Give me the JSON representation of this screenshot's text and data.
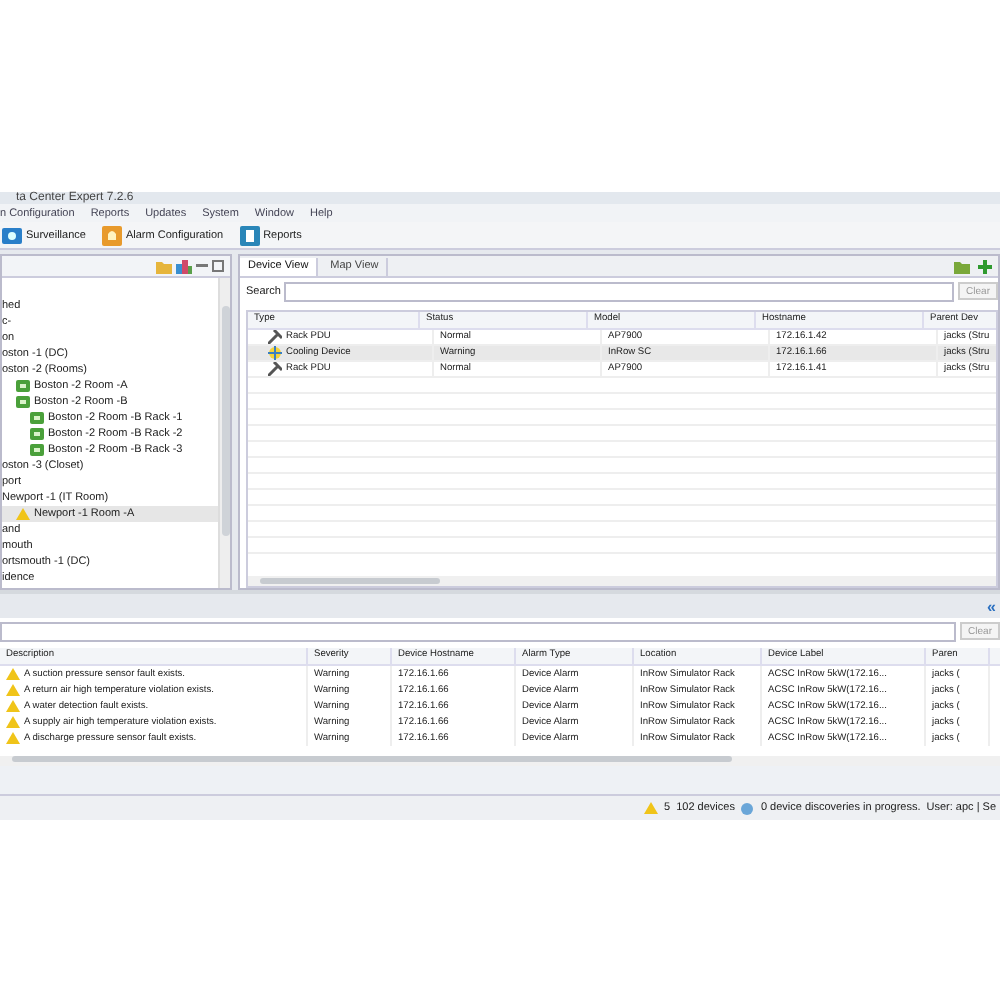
{
  "window": {
    "title": "ta Center Expert 7.2.6"
  },
  "menu": [
    "n Configuration",
    "Reports",
    "Updates",
    "System",
    "Window",
    "Help"
  ],
  "toolbar": [
    {
      "label": "Surveillance",
      "kind": "surveillance"
    },
    {
      "label": "Alarm Configuration",
      "kind": "alarm"
    },
    {
      "label": "Reports",
      "kind": "reports"
    }
  ],
  "tree": [
    {
      "label": "hed",
      "selected": false
    },
    {
      "label": "c-",
      "selected": false
    },
    {
      "label": "on",
      "selected": false
    },
    {
      "label": "oston -1 (DC)",
      "selected": false
    },
    {
      "label": "oston -2 (Rooms)",
      "selected": false,
      "children": [
        {
          "label": "Boston -2 Room -A",
          "kind": "room",
          "selected": false
        },
        {
          "label": "Boston -2 Room -B",
          "kind": "room",
          "selected": false,
          "children": [
            {
              "label": "Boston -2 Room -B Rack -1",
              "kind": "room",
              "selected": false
            },
            {
              "label": "Boston -2 Room -B Rack -2",
              "kind": "room",
              "selected": false
            },
            {
              "label": "Boston -2 Room -B Rack -3",
              "kind": "room",
              "selected": false
            }
          ]
        }
      ]
    },
    {
      "label": "oston -3 (Closet)",
      "selected": false
    },
    {
      "label": "port",
      "selected": false
    },
    {
      "label": "Newport -1 (IT Room)",
      "selected": false,
      "children": [
        {
          "label": "Newport -1 Room -A",
          "kind": "warning",
          "selected": true
        }
      ]
    },
    {
      "label": "and",
      "selected": false
    },
    {
      "label": "mouth",
      "selected": false
    },
    {
      "label": "ortsmouth -1 (DC)",
      "selected": false
    },
    {
      "label": "idence",
      "selected": false
    }
  ],
  "view_tabs": [
    {
      "label": "Device View",
      "selected": true
    },
    {
      "label": "Map View",
      "selected": false
    }
  ],
  "search": {
    "label": "Search",
    "clear": "Clear"
  },
  "devices": {
    "columns": [
      "Type",
      "Status",
      "Model",
      "Hostname",
      "Parent Dev"
    ],
    "rows": [
      {
        "kind": "pdu",
        "cells": [
          "Rack PDU",
          "Normal",
          "AP7900",
          "172.16.1.42",
          "jacks (Stru"
        ],
        "selected": false
      },
      {
        "kind": "cooling",
        "cells": [
          "Cooling Device",
          "Warning",
          "InRow SC",
          "172.16.1.66",
          "jacks (Stru"
        ],
        "selected": true
      },
      {
        "kind": "pdu",
        "cells": [
          "Rack PDU",
          "Normal",
          "AP7900",
          "172.16.1.41",
          "jacks (Stru"
        ],
        "selected": false
      }
    ]
  },
  "alarms": {
    "collapse": "«",
    "clear": "Clear",
    "columns": [
      "Description",
      "Severity",
      "Device Hostname",
      "Alarm Type",
      "Location",
      "Device Label",
      "Paren"
    ],
    "rows": [
      [
        "A suction pressure sensor fault exists.",
        "Warning",
        "172.16.1.66",
        "Device Alarm",
        "InRow Simulator Rack",
        "ACSC InRow 5kW(172.16...",
        "jacks ("
      ],
      [
        "A return air high temperature violation exists.",
        "Warning",
        "172.16.1.66",
        "Device Alarm",
        "InRow Simulator Rack",
        "ACSC InRow 5kW(172.16...",
        "jacks ("
      ],
      [
        "A water detection fault exists.",
        "Warning",
        "172.16.1.66",
        "Device Alarm",
        "InRow Simulator Rack",
        "ACSC InRow 5kW(172.16...",
        "jacks ("
      ],
      [
        "A supply air high temperature violation exists.",
        "Warning",
        "172.16.1.66",
        "Device Alarm",
        "InRow Simulator Rack",
        "ACSC InRow 5kW(172.16...",
        "jacks ("
      ],
      [
        "A discharge pressure sensor fault exists.",
        "Warning",
        "172.16.1.66",
        "Device Alarm",
        "InRow Simulator Rack",
        "ACSC InRow 5kW(172.16...",
        "jacks ("
      ]
    ]
  },
  "status_bar": {
    "alarm_count": "5",
    "devices": "102 devices",
    "discoveries": "0 device discoveries in progress.",
    "user": "User: apc | Se"
  }
}
